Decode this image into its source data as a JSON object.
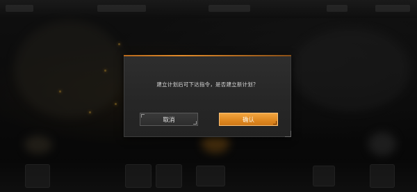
{
  "dialog": {
    "message": "建立计划后可下达指令，是否建立新计划？",
    "cancel_label": "取消",
    "confirm_label": "确认"
  },
  "colors": {
    "accent": "#e08a22",
    "dialog_bg": "#2a2a2a",
    "overlay": "#000000"
  }
}
